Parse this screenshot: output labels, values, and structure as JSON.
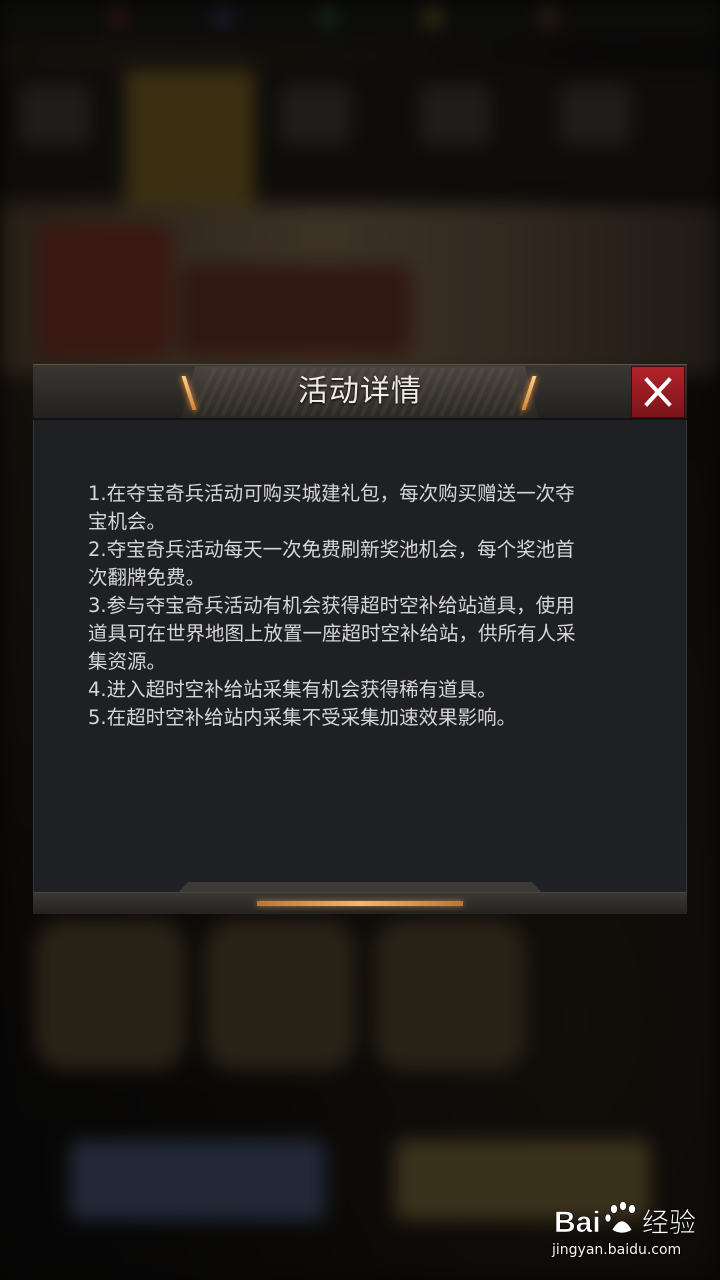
{
  "dialog": {
    "title": "活动详情",
    "close_icon": "close-icon",
    "rules": [
      "1.在夺宝奇兵活动可购买城建礼包，每次购买赠送一次夺",
      "宝机会。",
      "2.夺宝奇兵活动每天一次免费刷新奖池机会，每个奖池首",
      "次翻牌免费。",
      "3.参与夺宝奇兵活动有机会获得超时空补给站道具，使用",
      "道具可在世界地图上放置一座超时空补给站，供所有人采",
      "集资源。",
      "4.进入超时空补给站采集有机会获得稀有道具。",
      "5.在超时空补给站内采集不受采集加速效果影响。"
    ]
  },
  "watermark": {
    "logo": "Baidu经验",
    "url": "jingyan.baidu.com"
  },
  "colors": {
    "dialog_bg": "#1f2023",
    "close_button": "#9c1d24",
    "accent": "#f0b774",
    "text": "#d6d6d6"
  }
}
